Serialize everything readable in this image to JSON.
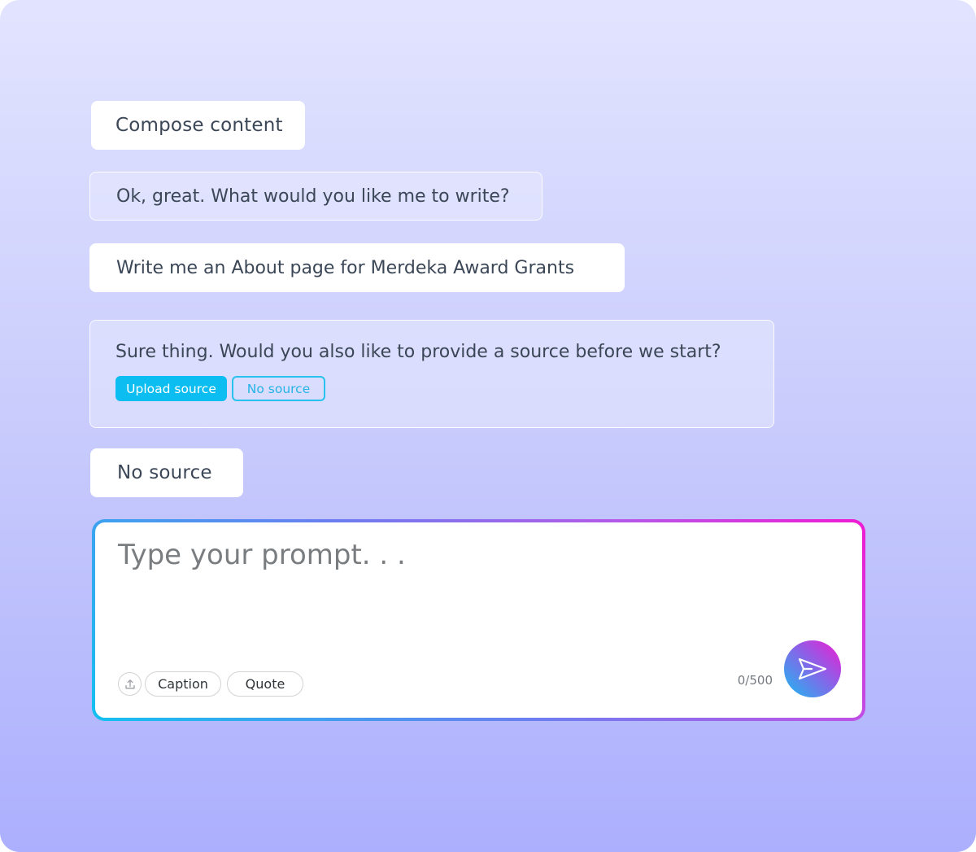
{
  "conversation": {
    "messages": [
      {
        "role": "user",
        "text": "Compose content"
      },
      {
        "role": "assistant",
        "text": "Ok, great. What would you like me to write?"
      },
      {
        "role": "user",
        "text": "Write me an About page for Merdeka Award Grants"
      },
      {
        "role": "assistant",
        "text": "Sure thing. Would you also like to provide a source before we start?",
        "actions": {
          "upload_label": "Upload source",
          "no_source_label": "No source"
        }
      },
      {
        "role": "user",
        "text": "No source"
      }
    ]
  },
  "composer": {
    "placeholder": "Type your prompt. . .",
    "value": "",
    "chips": {
      "caption": "Caption",
      "quote": "Quote"
    },
    "counter": "0/500",
    "icons": {
      "upload": "upload-icon",
      "send": "send-icon"
    }
  },
  "colors": {
    "accent": "#0bbdf0",
    "text": "#3b4757",
    "gradient_start": "#14c0f0",
    "gradient_end": "#f01ad2"
  }
}
